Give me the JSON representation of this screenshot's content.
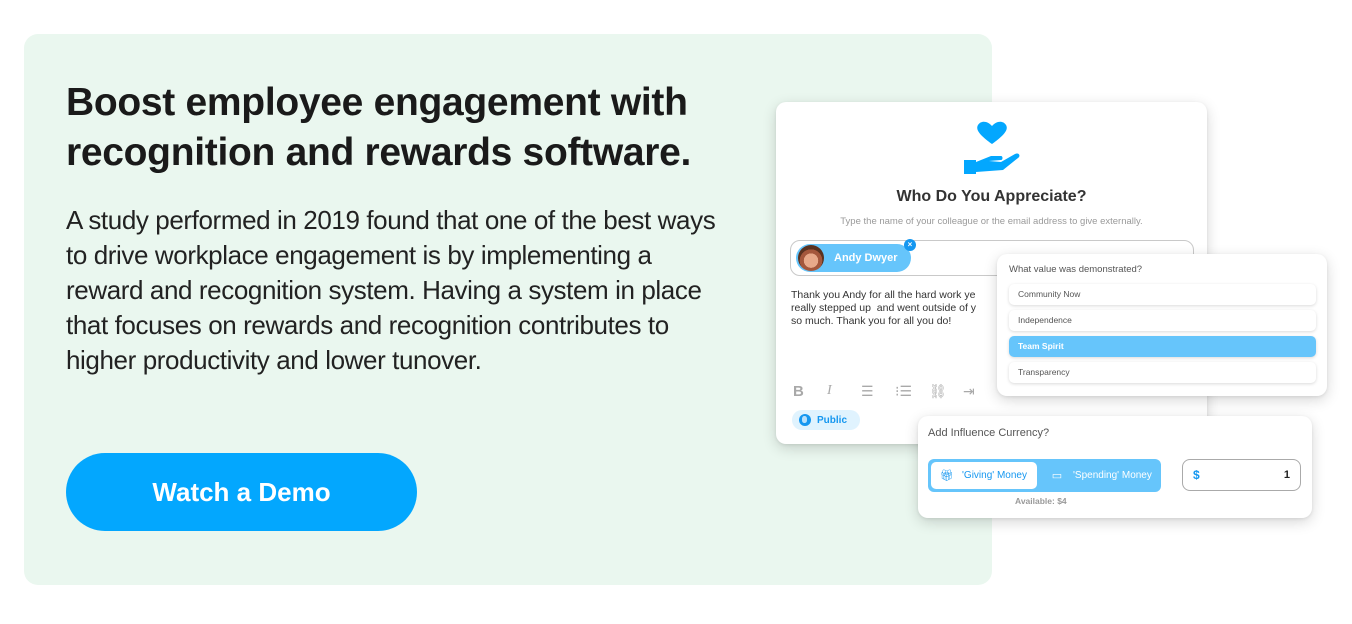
{
  "hero": {
    "headline": "Boost employee engagement with recognition and rewards software.",
    "body": "A study performed in 2019 found that one of the best ways to drive workplace engagement is by implementing a reward and recognition system. Having a system in place that focuses on rewards and recognition contributes to higher productivity and lower tunover.",
    "cta_label": "Watch a Demo",
    "background_color": "#eaf7ef",
    "cta_color": "#03a7fe"
  },
  "appreciate_card": {
    "icon": "heart-in-hand-icon",
    "title": "Who Do You Appreciate?",
    "subtitle": "Type the name of your colleague or the email address to give externally.",
    "recipient": {
      "name": "Andy Dwyer",
      "remove_icon": "close-icon"
    },
    "message": "Thank you Andy for all the hard work ye\nreally stepped up  and went outside of y\nso much. Thank you for all you do!",
    "toolbar": [
      {
        "icon": "bold-icon",
        "glyph": "B"
      },
      {
        "icon": "italic-icon",
        "glyph": "I"
      },
      {
        "icon": "bullet-list-icon",
        "glyph": "☰"
      },
      {
        "icon": "numbered-list-icon",
        "glyph": "⁝☰"
      },
      {
        "icon": "link-icon",
        "glyph": "🔗"
      },
      {
        "icon": "insert-icon",
        "glyph": "⇥"
      }
    ],
    "visibility": "Public"
  },
  "values_card": {
    "question": "What value was demonstrated?",
    "options": [
      {
        "label": "Community Now",
        "selected": false
      },
      {
        "label": "Independence",
        "selected": false
      },
      {
        "label": "Team Spirit",
        "selected": true
      },
      {
        "label": "Transparency",
        "selected": false
      }
    ]
  },
  "currency_card": {
    "question": "Add Influence Currency?",
    "toggle": [
      {
        "label": "'Giving' Money",
        "icon": "gift-icon",
        "active": true
      },
      {
        "label": "'Spending' Money",
        "icon": "credit-card-icon",
        "active": false
      }
    ],
    "available": "Available: $4",
    "amount": {
      "currency_symbol": "$",
      "value": "1"
    }
  },
  "colors": {
    "accent": "#1597f0",
    "chip": "#66c5fb"
  }
}
